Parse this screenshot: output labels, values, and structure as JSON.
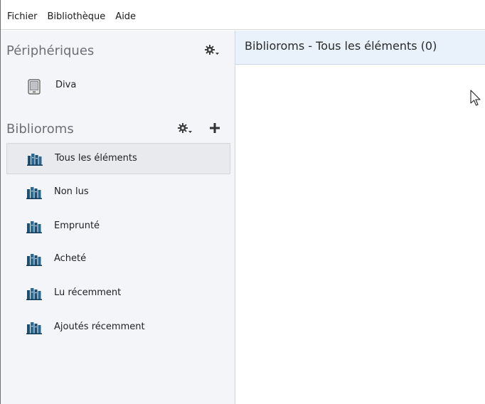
{
  "menu": {
    "items": [
      "Fichier",
      "Bibliothèque",
      "Aide"
    ]
  },
  "sidebar": {
    "devices": {
      "title": "Périphériques",
      "items": [
        {
          "label": "Diva",
          "icon": "ereader-device-icon"
        }
      ]
    },
    "collections": {
      "title": "Biblioroms",
      "items": [
        {
          "label": "Tous les éléments",
          "selected": true,
          "icon": "bookshelf-icon"
        },
        {
          "label": "Non lus",
          "selected": false,
          "icon": "bookshelf-icon"
        },
        {
          "label": "Emprunté",
          "selected": false,
          "icon": "bookshelf-icon"
        },
        {
          "label": "Acheté",
          "selected": false,
          "icon": "bookshelf-icon"
        },
        {
          "label": "Lu récemment",
          "selected": false,
          "icon": "bookshelf-icon"
        },
        {
          "label": "Ajoutés récemment",
          "selected": false,
          "icon": "bookshelf-icon"
        }
      ]
    }
  },
  "content": {
    "title": "Biblioroms - Tous les éléments (0)"
  },
  "colors": {
    "accent_header": "#e9f1fb",
    "sidebar_bg": "#f3f5f9",
    "icon_blue": "#1c4f73"
  }
}
